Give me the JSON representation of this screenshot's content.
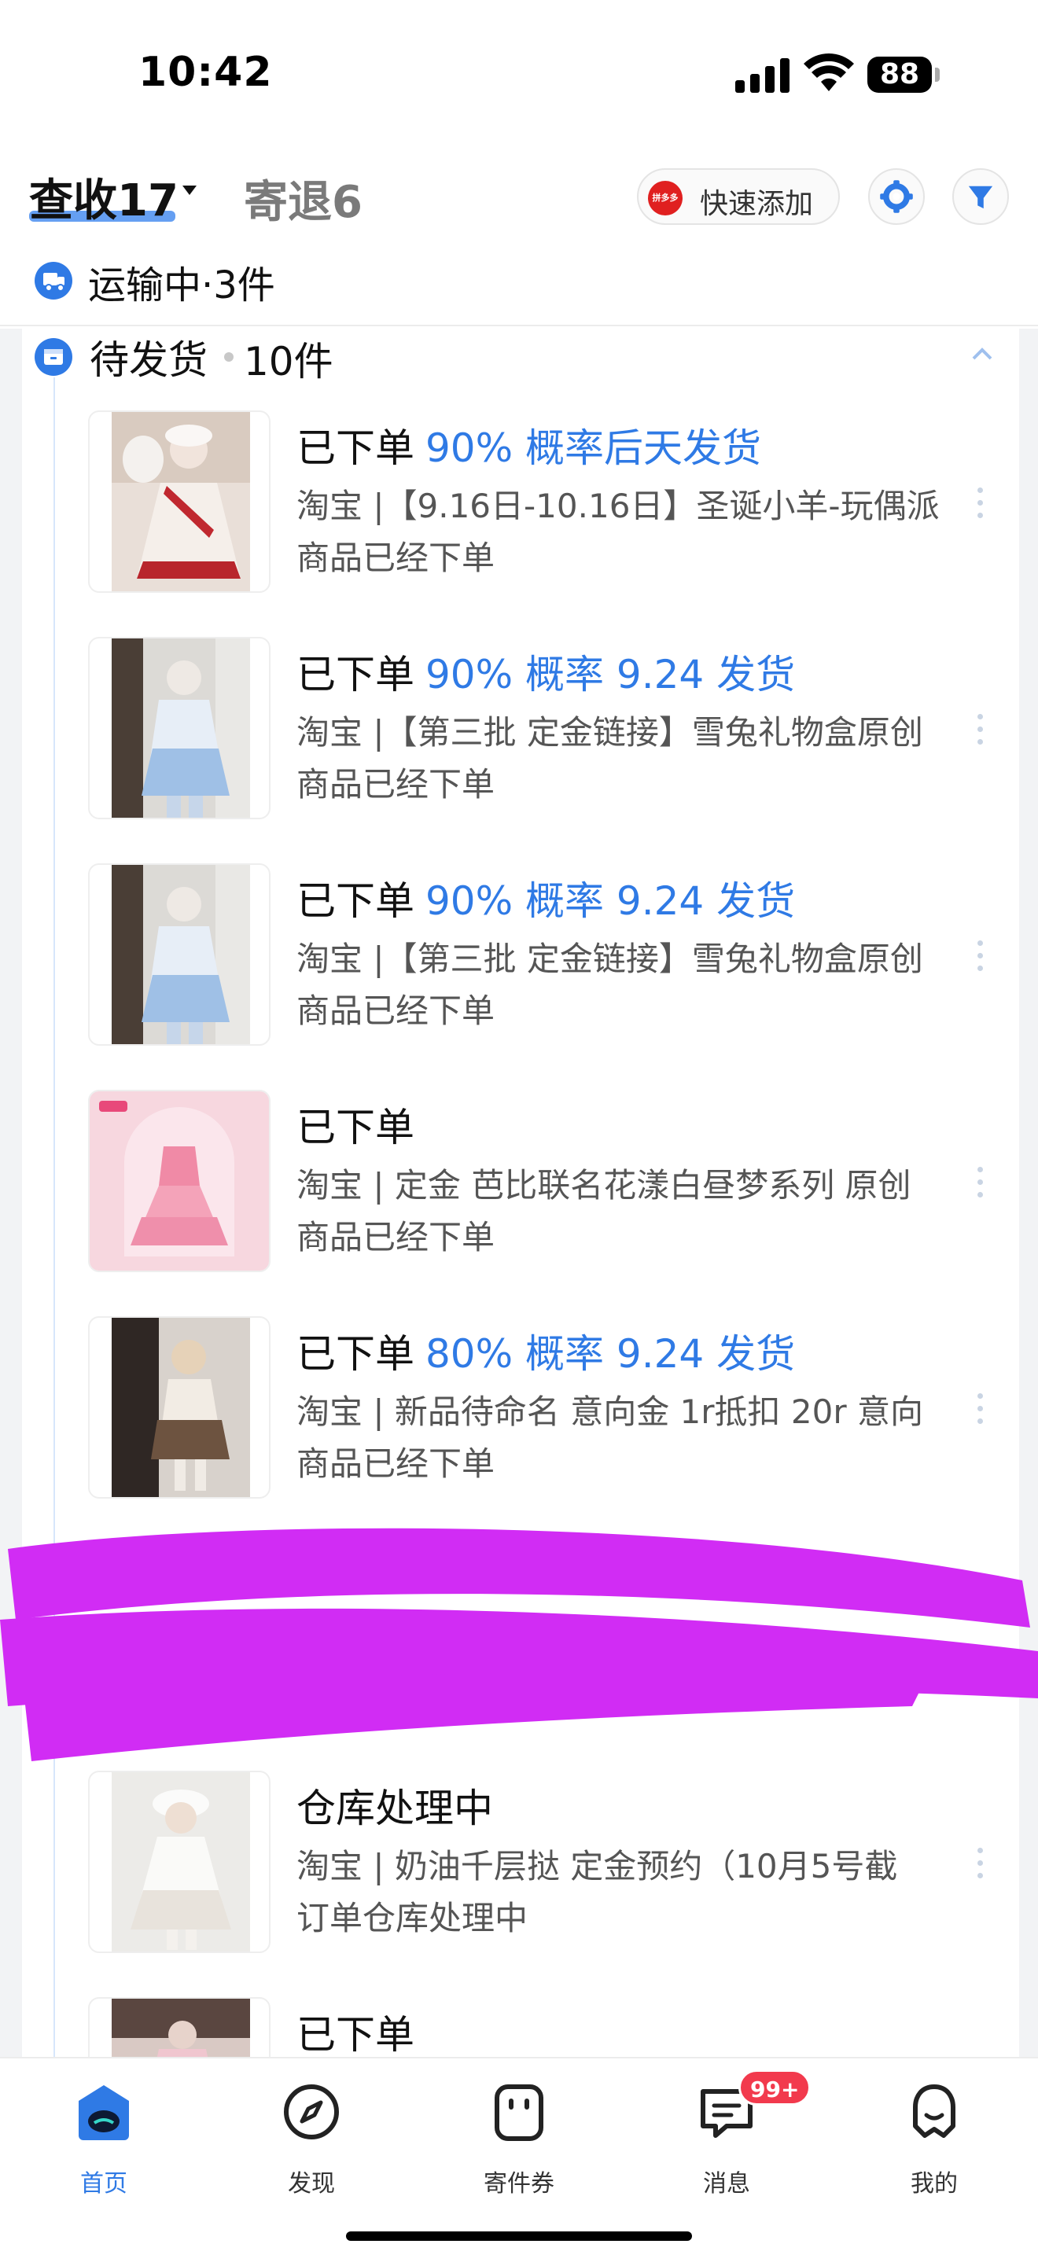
{
  "status_bar": {
    "time": "10:42",
    "battery": "88"
  },
  "header": {
    "active_tab": "查收17",
    "inactive_tab": "寄退6",
    "quick_add": {
      "logo": "拼多多",
      "label": "快速添加"
    },
    "icons": [
      "gear-icon",
      "filter-icon"
    ]
  },
  "transit": {
    "label": "运输中·3件"
  },
  "pending": {
    "title": "待发货",
    "count": "10件"
  },
  "orders": [
    {
      "status": "已下单",
      "eta": "90% 概率后天发货",
      "title": "淘宝 |【9.16日-10.16日】圣诞小羊-玩偶派",
      "sub": "商品已经下单"
    },
    {
      "status": "已下单",
      "eta": "90% 概率 9.24 发货",
      "title": "淘宝 |【第三批 定金链接】雪兔礼物盒原创",
      "sub": "商品已经下单"
    },
    {
      "status": "已下单",
      "eta": "90% 概率 9.24 发货",
      "title": "淘宝 |【第三批 定金链接】雪兔礼物盒原创",
      "sub": "商品已经下单"
    },
    {
      "status": "已下单",
      "eta": "",
      "title": "淘宝 | 定金 芭比联名花漾白昼梦系列 原创",
      "sub": "商品已经下单"
    },
    {
      "status": "已下单",
      "eta": "80% 概率 9.24 发货",
      "title": "淘宝 | 新品待命名 意向金 1r抵扣 20r 意向",
      "sub": "商品已经下单"
    },
    {
      "status": "仓库处理中",
      "eta": "",
      "title": "淘宝 | 奶油千层挞 定金预约（10月5号截",
      "sub": "订单仓库处理中"
    },
    {
      "status": "已下单",
      "eta": "",
      "title": "",
      "sub": ""
    }
  ],
  "tabbar": {
    "items": [
      {
        "label": "首页",
        "icon": "home-icon"
      },
      {
        "label": "发现",
        "icon": "compass-icon"
      },
      {
        "label": "寄件券",
        "icon": "coupon-icon"
      },
      {
        "label": "消息",
        "icon": "message-icon",
        "badge": "99+"
      },
      {
        "label": "我的",
        "icon": "profile-icon"
      }
    ]
  },
  "colors": {
    "accent": "#2f7ae5",
    "badge": "#f23a4d",
    "redaction": "#d12cf4"
  }
}
